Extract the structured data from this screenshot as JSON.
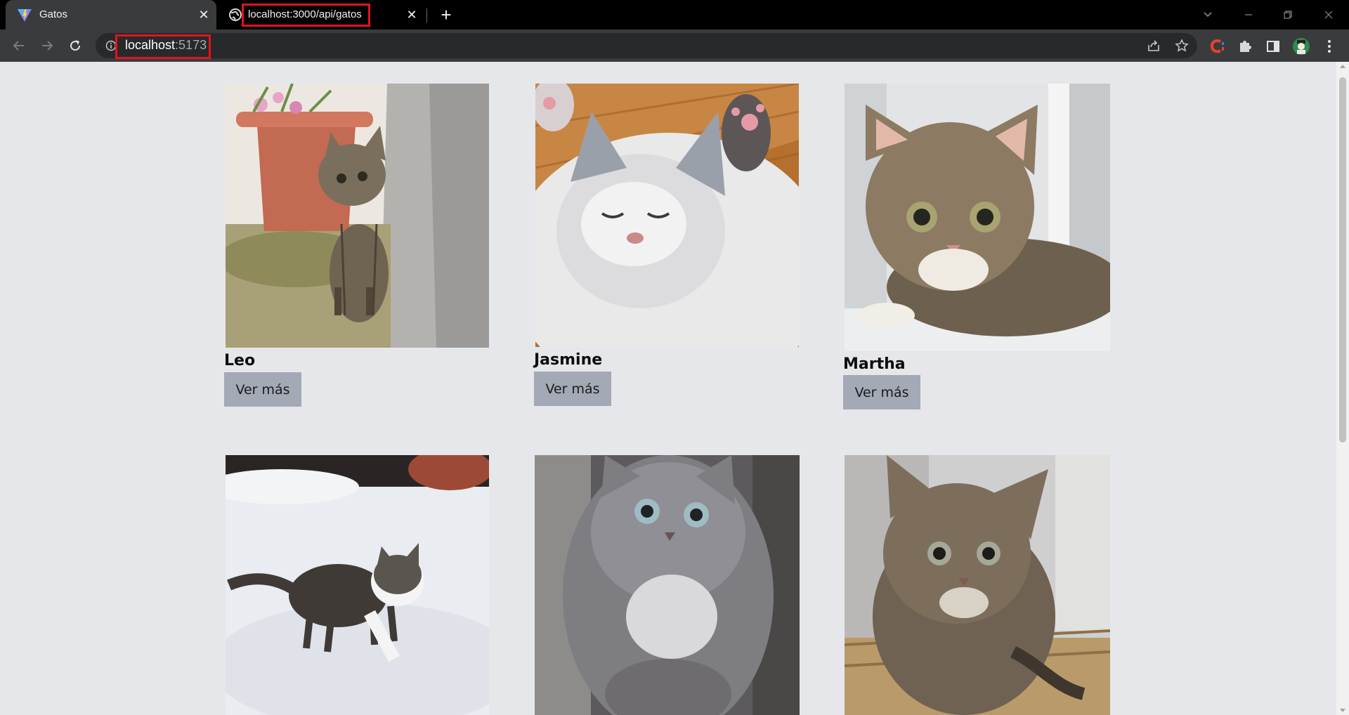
{
  "browser": {
    "tabs": [
      {
        "title": "Gatos",
        "favicon": "vite-icon",
        "active": true
      },
      {
        "title": "localhost:3000/api/gatos",
        "favicon": "globe-icon",
        "active": false
      }
    ],
    "url": {
      "host": "localhost",
      "port": ":5173"
    },
    "annotation_color": "#e3131e"
  },
  "page": {
    "background": "#e6e7ea",
    "button_color": "#a3a9b5",
    "cats": [
      {
        "name": "Leo",
        "button_label": "Ver más",
        "photo": "kitten sitting by flower pot"
      },
      {
        "name": "Jasmine",
        "button_label": "Ver más",
        "photo": "white kitten sleeping on back"
      },
      {
        "name": "Martha",
        "button_label": "Ver más",
        "photo": "tabby kitten lying on window sill"
      },
      {
        "name": "",
        "button_label": "",
        "photo": "tabby kitten walking in snow"
      },
      {
        "name": "",
        "button_label": "",
        "photo": "grey fluffy kitten"
      },
      {
        "name": "",
        "button_label": "",
        "photo": "brown tabby kitten in basket"
      }
    ]
  }
}
